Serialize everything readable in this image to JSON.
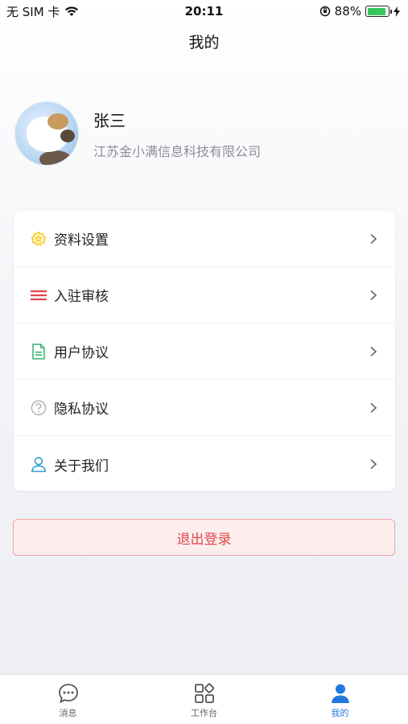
{
  "status_bar": {
    "carrier": "无 SIM 卡",
    "time": "20:11",
    "battery_pct": "88%",
    "battery_level": 0.88
  },
  "header": {
    "title": "我的"
  },
  "profile": {
    "name": "张三",
    "company": "江苏金小满信息科技有限公司"
  },
  "menu": {
    "items": [
      {
        "label": "资料设置",
        "icon": "star-badge-icon",
        "color": "#f5c518"
      },
      {
        "label": "入驻审核",
        "icon": "list-icon",
        "color": "#e0474c"
      },
      {
        "label": "用户协议",
        "icon": "document-icon",
        "color": "#34b36e"
      },
      {
        "label": "隐私协议",
        "icon": "question-icon",
        "color": "#b0b3b8"
      },
      {
        "label": "关于我们",
        "icon": "user-icon",
        "color": "#2d9ad8"
      }
    ]
  },
  "logout": {
    "label": "退出登录"
  },
  "tab_bar": {
    "tabs": [
      {
        "label": "消息",
        "icon": "chat-icon",
        "active": false
      },
      {
        "label": "工作台",
        "icon": "grid-icon",
        "active": false
      },
      {
        "label": "我的",
        "icon": "person-icon",
        "active": true
      }
    ]
  },
  "colors": {
    "accent": "#1f7ae0",
    "logout_text": "#e0474c",
    "logout_bg": "#fdeeee"
  }
}
